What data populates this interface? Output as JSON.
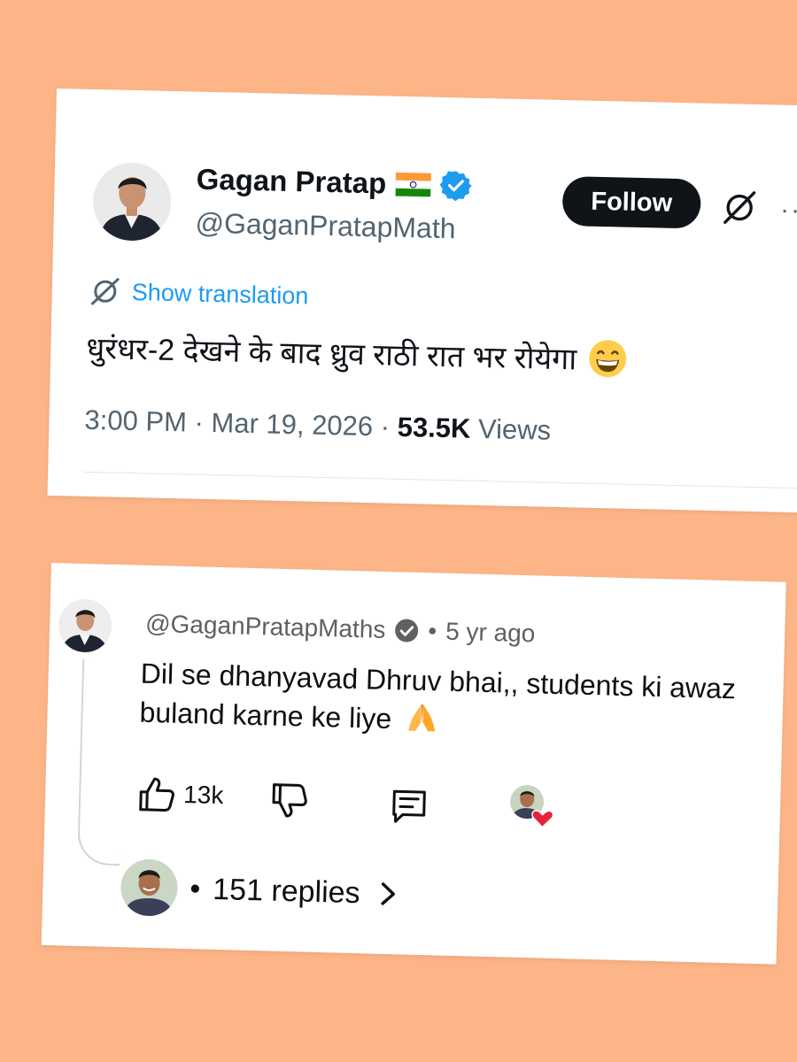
{
  "tweet": {
    "author_name": "Gagan Pratap",
    "author_handle": "@GaganPratapMath",
    "follow_label": "Follow",
    "more_label": "··",
    "translate_label": "Show translation",
    "text": "धुरंधर-2 देखने के बाद ध्रुव राठी रात भर रोयेगा",
    "time": "3:00 PM",
    "separator": "·",
    "date": "Mar 19, 2026",
    "views_count": "53.5K",
    "views_label": "Views",
    "colors": {
      "accent": "#1d9bf0",
      "button": "#0f1419",
      "muted": "#536471"
    }
  },
  "comment": {
    "handle": "@GaganPratapMaths",
    "separator": "•",
    "age": "5 yr ago",
    "text": "Dil se dhanyavad Dhruv bhai,, students ki awaz buland karne ke liye",
    "like_count": "13k",
    "replies_bullet": "•",
    "replies_label": "151 replies",
    "icons": [
      "like-icon",
      "dislike-icon",
      "reply-icon",
      "creator-heart-icon",
      "chevron-right-icon"
    ]
  },
  "background_color": "#fdb588"
}
